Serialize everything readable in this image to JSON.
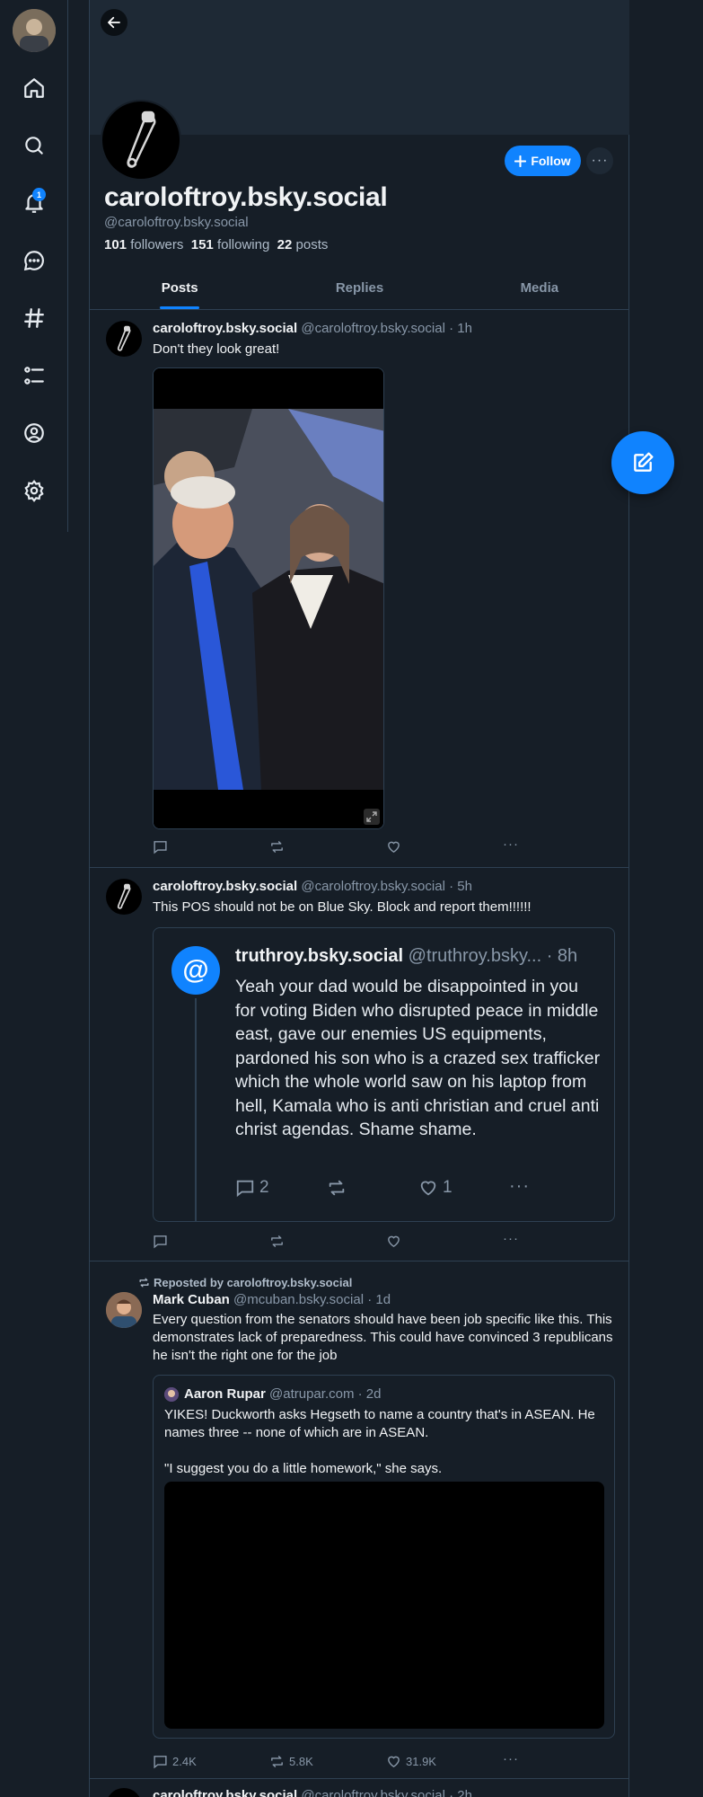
{
  "colors": {
    "background": "#161e27",
    "accent": "#1083fe",
    "border": "#2e4052",
    "muted": "#8897a8"
  },
  "nav": {
    "items": [
      {
        "icon": "home-icon"
      },
      {
        "icon": "search-icon"
      },
      {
        "icon": "bell-icon",
        "badge": "1"
      },
      {
        "icon": "chat-icon"
      },
      {
        "icon": "hashtag-icon"
      },
      {
        "icon": "list-icon"
      },
      {
        "icon": "profile-icon"
      },
      {
        "icon": "settings-icon"
      }
    ]
  },
  "profile": {
    "display_name": "caroloftroy.bsky.social",
    "handle": "@caroloftroy.bsky.social",
    "followers_count": "101",
    "followers_label": "followers",
    "following_count": "151",
    "following_label": "following",
    "posts_count": "22",
    "posts_label": "posts",
    "follow_label": "Follow"
  },
  "tabs": [
    {
      "label": "Posts",
      "active": true
    },
    {
      "label": "Replies",
      "active": false
    },
    {
      "label": "Media",
      "active": false
    }
  ],
  "posts": [
    {
      "author": "caroloftroy.bsky.social",
      "handle": "@caroloftroy.bsky.social",
      "time": "· 1h",
      "text": "Don't they look great!"
    },
    {
      "author": "caroloftroy.bsky.social",
      "handle": "@caroloftroy.bsky.social",
      "time": "· 5h",
      "text": "This POS should not be on Blue Sky. Block and report them!!!!!!",
      "quote": {
        "author": "truthroy.bsky.social",
        "handle": "@truthroy.bsky...",
        "time": "· 8h",
        "text": "Yeah your dad would be disappointed in you for voting Biden who disrupted peace in middle east, gave our enemies US equipments, pardoned his son who is a crazed sex trafficker which the whole world saw on his laptop from hell, Kamala who is anti christian and cruel anti christ agendas. Shame shame.",
        "replies": "2",
        "likes": "1"
      }
    },
    {
      "repost_label": "Reposted by caroloftroy.bsky.social",
      "author": "Mark Cuban",
      "handle": "@mcuban.bsky.social",
      "time": "· 1d",
      "text": "Every question from the senators should have been job specific like this. This demonstrates lack of preparedness.  This could have convinced 3 republicans he isn't the right one for the job",
      "quote": {
        "author": "Aaron Rupar",
        "handle": "@atrupar.com",
        "time": "· 2d",
        "text": "YIKES! Duckworth asks Hegseth to name a country that's in ASEAN. He names three -- none of which are in ASEAN.\n\n\"I suggest you do a little homework,\" she says."
      },
      "replies": "2.4K",
      "reposts": "5.8K",
      "likes": "31.9K"
    },
    {
      "author": "caroloftroy.bsky.social",
      "handle": "@caroloftroy.bsky.social",
      "time": "· 2h"
    }
  ]
}
